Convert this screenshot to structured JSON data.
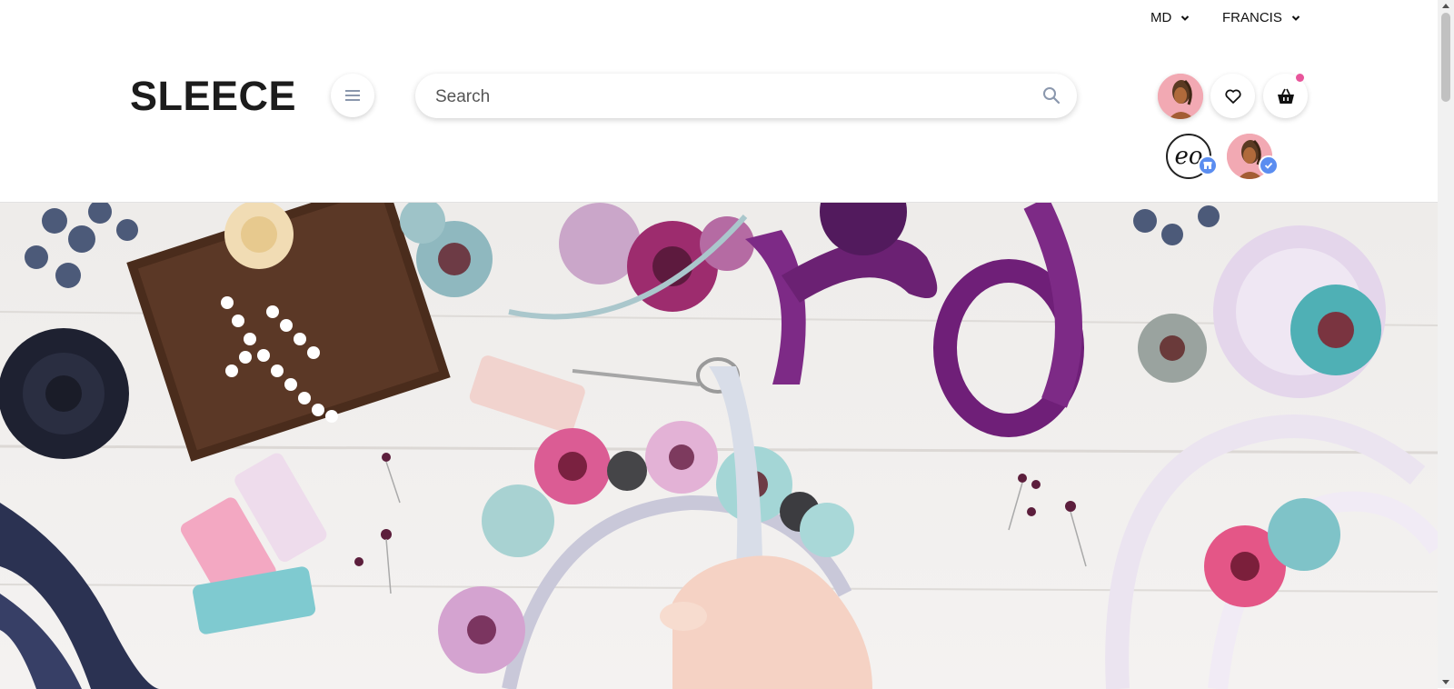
{
  "topbar": {
    "currency": "MD",
    "user_name": "FRANCIS"
  },
  "header": {
    "logo": "SLEECE",
    "search_placeholder": "Search"
  },
  "icons": {
    "menu": "hamburger-icon",
    "search": "search-icon",
    "wishlist": "heart-icon",
    "cart": "basket-icon",
    "store_badge": "store-icon",
    "verified_badge": "check-icon"
  },
  "accounts": {
    "store_logo_text": "eo"
  },
  "colors": {
    "cart_badge": "#e8559b",
    "account_badge": "#5b8df0"
  }
}
